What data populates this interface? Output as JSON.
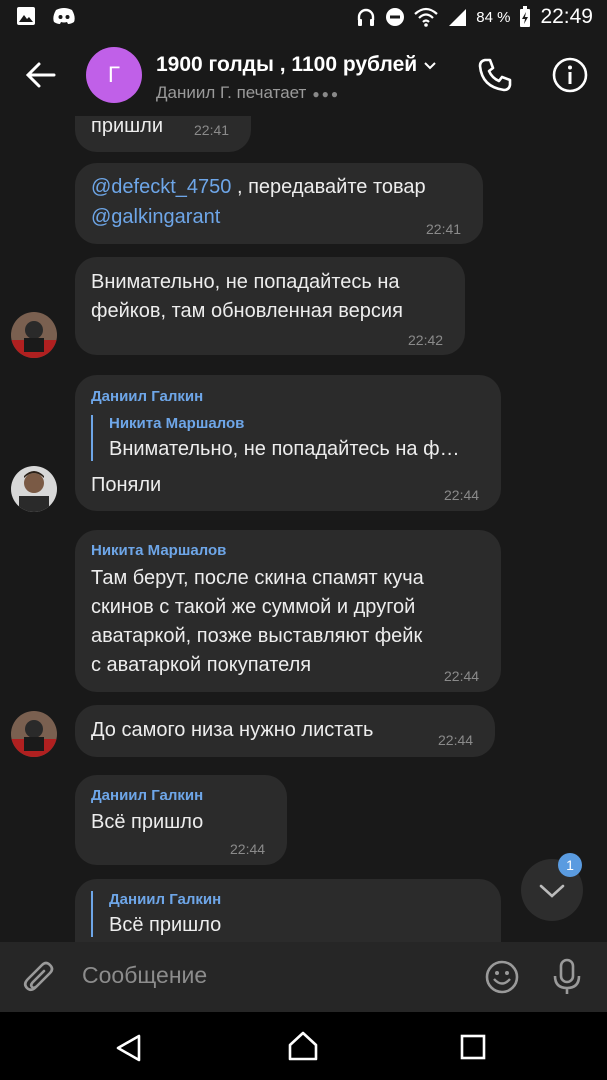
{
  "status_bar": {
    "battery_percent": "84 %",
    "time": "22:49"
  },
  "header": {
    "avatar_letter": "Г",
    "title": "1900 голды , 1100 рублей",
    "subtitle": "Даниил Г. печатает"
  },
  "messages": [
    {
      "text": "пришли",
      "time": "22:41"
    },
    {
      "mention1": "@defeckt_4750",
      "text": " , передавайте товар",
      "mention2": "@galkingarant",
      "time": "22:41"
    },
    {
      "lines": [
        "Внимательно, не попадайтесь на",
        "фейков, там обновленная версия"
      ],
      "time": "22:42"
    },
    {
      "sender": "Даниил Галкин",
      "reply_name": "Никита Маршалов",
      "reply_text": "Внимательно, не попадайтесь на ф…",
      "text": "Поняли",
      "time": "22:44"
    },
    {
      "sender": "Никита Маршалов",
      "lines": [
        "Там берут, после скина спамят куча",
        "скинов с такой же суммой и другой",
        "аватаркой, позже выставляют фейк",
        "с аватаркой покупателя"
      ],
      "time": "22:44"
    },
    {
      "text": "До самого низа нужно листать",
      "time": "22:44"
    },
    {
      "sender": "Даниил Галкин",
      "text": "Всё пришло",
      "time": "22:44"
    },
    {
      "reply_name": "Даниил Галкин",
      "reply_text": "Всё пришло"
    }
  ],
  "unread_badge": "1",
  "composer": {
    "placeholder": "Сообщение"
  }
}
